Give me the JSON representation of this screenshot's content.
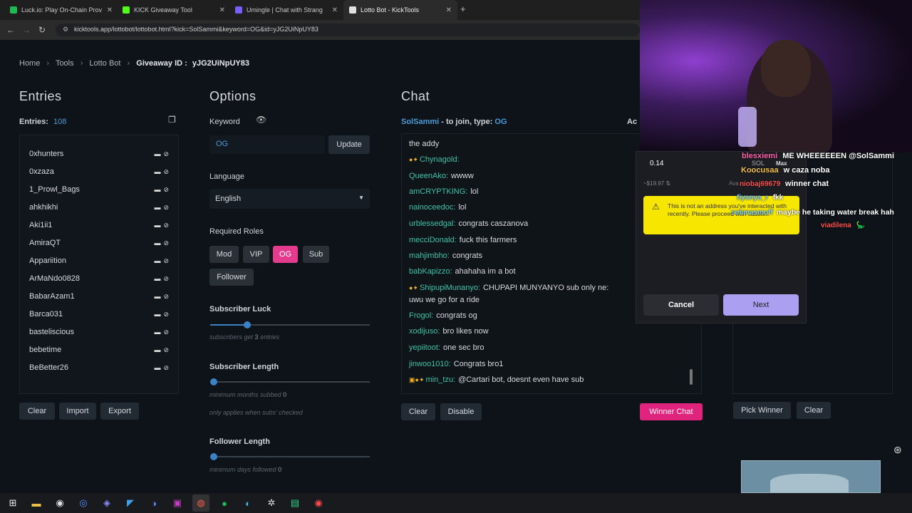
{
  "browser": {
    "tabs": [
      {
        "title": "Luck.io: Play On-Chain Prov",
        "color": "#1db954"
      },
      {
        "title": "KICK Giveaway Tool",
        "color": "#53fc18"
      },
      {
        "title": "Umingle | Chat with Strang",
        "color": "#7b5cff"
      },
      {
        "title": "Lotto Bot - KickTools",
        "color": "#e0e0e0"
      }
    ],
    "new_tab": "+",
    "url": "kicktools.app/lottobot/lottobot.html?kick=SolSammi&keyword=OG&id=yJG2UiNpUY83"
  },
  "breadcrumb": {
    "home": "Home",
    "tools": "Tools",
    "lotto": "Lotto Bot",
    "giveaway_label": "Giveaway ID :",
    "giveaway_id": "yJG2UiNpUY83"
  },
  "entries": {
    "title": "Entries",
    "count_label": "Entries:",
    "count": "108",
    "items": [
      "0xhunters",
      "0xzaza",
      "1_Prowl_Bags",
      "ahkhikhi",
      "Aki1ii1",
      "AmiraQT",
      "Appariition",
      "ArMaNdo0828",
      "BabarAzam1",
      "Barca031",
      "basteliscious",
      "bebetime",
      "BeBetter26"
    ],
    "clear": "Clear",
    "import": "Import",
    "export": "Export"
  },
  "options": {
    "title": "Options",
    "keyword_label": "Keyword",
    "keyword_value": "OG",
    "update": "Update",
    "language_label": "Language",
    "language_value": "English",
    "roles_label": "Required Roles",
    "roles": [
      "Mod",
      "VIP",
      "OG",
      "Sub",
      "Follower"
    ],
    "sub_luck_label": "Subscriber Luck",
    "sub_luck_value": 0.23,
    "sub_luck_hint_pre": "subscribers get",
    "sub_luck_hint_val": "3",
    "sub_luck_hint_post": "entries",
    "sub_len_label": "Subscriber Length",
    "sub_len_hint_pre": "minimum months subbed",
    "sub_len_hint_val": "0",
    "sub_len_hint2": "only applies when subs' checked",
    "fol_len_label": "Follower Length",
    "fol_len_hint_pre": "minimum days followed",
    "fol_len_hint_val": "0"
  },
  "chat": {
    "title": "Chat",
    "channel": "SolSammi",
    "join_text": "- to join, type:",
    "keyword": "OG",
    "cut_label": "Ac",
    "messages": [
      {
        "user": "",
        "text": "the addy"
      },
      {
        "user": "Chynagold:",
        "text": "",
        "badge": "●✦"
      },
      {
        "user": "QueenAko:",
        "text": "wwww"
      },
      {
        "user": "amCRYPTKING:",
        "text": "lol"
      },
      {
        "user": "nainoceedoc:",
        "text": "lol"
      },
      {
        "user": "urblessedgal:",
        "text": "congrats caszanova"
      },
      {
        "user": "mecciDonald:",
        "text": "fuck this farmers"
      },
      {
        "user": "mahjimbho:",
        "text": "congrats"
      },
      {
        "user": "babKapizzo:",
        "text": "ahahaha im a bot"
      },
      {
        "user": "ShipupiMunanyo:",
        "text": "CHUPAPI MUNYANYO sub only ne:",
        "badge": "●✦"
      },
      {
        "user": "",
        "text": "uwu we go for a ride"
      },
      {
        "user": "Frogol:",
        "text": "congrats og"
      },
      {
        "user": "xodijuso:",
        "text": "bro likes now"
      },
      {
        "user": "yepiitoot:",
        "text": "one sec bro"
      },
      {
        "user": "jinwoo1010:",
        "text": "Congrats bro1"
      },
      {
        "user": "min_tzu:",
        "text": "@Cartari bot, doesnt even have sub",
        "badge": "▣●✦"
      }
    ],
    "clear": "Clear",
    "disable": "Disable",
    "winner_chat": "Winner Chat"
  },
  "winner": {
    "pick": "Pick Winner",
    "clear": "Clear"
  },
  "wallet": {
    "amount": "0.14",
    "currency": "SOL",
    "max": "Max",
    "usd": "~$19.97",
    "available": "Ava",
    "warning": "This is not an address you've interacted with recently. Please proceed with caution.",
    "cancel": "Cancel",
    "next": "Next"
  },
  "stream_chat": [
    {
      "user": "blesxiemi",
      "text": "ME WHEEEEEEN @SolSammi",
      "color": "#ff5fa8"
    },
    {
      "user": "Koocusaa",
      "text": "w caza noba",
      "color": "#f1c24a"
    },
    {
      "user": "niobaj69679",
      "text": "winner chat",
      "color": "#ff5252"
    },
    {
      "user": "fiyanya_r",
      "text": "fkk",
      "color": "#7fd3ff"
    },
    {
      "user": "solanasmuff",
      "text": "maybe he taking water break hah",
      "color": "#7fd3ff"
    },
    {
      "user": "viadilena",
      "text": "🦕",
      "color": "#ff4f4f"
    }
  ],
  "taskbar_icons": [
    "windows-icon",
    "file-explorer-icon",
    "steam-icon",
    "browser-icon",
    "discord-icon",
    "vscode-icon",
    "app-icon",
    "kick-icon",
    "chrome-icon",
    "spotify-icon",
    "edge-icon",
    "settings-icon",
    "app2-icon",
    "app3-icon"
  ]
}
